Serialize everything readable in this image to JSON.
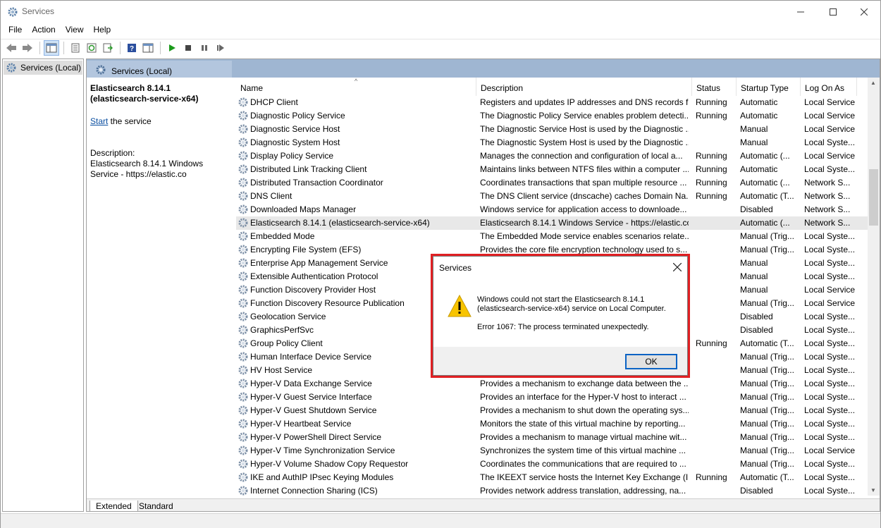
{
  "window": {
    "title": "Services"
  },
  "menu": [
    "File",
    "Action",
    "View",
    "Help"
  ],
  "tree": {
    "root_label": "Services (Local)"
  },
  "pane": {
    "header_title": "Services (Local)"
  },
  "detail": {
    "service_title": "Elasticsearch 8.14.1 (elasticsearch-service-x64)",
    "start_link": "Start",
    "start_suffix": " the service",
    "description_label": "Description:",
    "description_text": "Elasticsearch 8.14.1 Windows Service - https://elastic.co"
  },
  "columns": [
    "Name",
    "Description",
    "Status",
    "Startup Type",
    "Log On As"
  ],
  "services": [
    [
      "DHCP Client",
      "Registers and updates IP addresses and DNS records f...",
      "Running",
      "Automatic",
      "Local Service"
    ],
    [
      "Diagnostic Policy Service",
      "The Diagnostic Policy Service enables problem detecti...",
      "Running",
      "Automatic",
      "Local Service"
    ],
    [
      "Diagnostic Service Host",
      "The Diagnostic Service Host is used by the Diagnostic ...",
      "",
      "Manual",
      "Local Service"
    ],
    [
      "Diagnostic System Host",
      "The Diagnostic System Host is used by the Diagnostic ...",
      "",
      "Manual",
      "Local Syste..."
    ],
    [
      "Display Policy Service",
      "Manages the connection and configuration of local a...",
      "Running",
      "Automatic (...",
      "Local Service"
    ],
    [
      "Distributed Link Tracking Client",
      "Maintains links between NTFS files within a computer ...",
      "Running",
      "Automatic",
      "Local Syste..."
    ],
    [
      "Distributed Transaction Coordinator",
      "Coordinates transactions that span multiple resource ...",
      "Running",
      "Automatic (...",
      "Network S..."
    ],
    [
      "DNS Client",
      "The DNS Client service (dnscache) caches Domain Na...",
      "Running",
      "Automatic (T...",
      "Network S..."
    ],
    [
      "Downloaded Maps Manager",
      "Windows service for application access to downloade...",
      "",
      "Disabled",
      "Network S..."
    ],
    [
      "Elasticsearch 8.14.1 (elasticsearch-service-x64)",
      "Elasticsearch 8.14.1 Windows Service - https://elastic.co",
      "",
      "Automatic (...",
      "Network S..."
    ],
    [
      "Embedded Mode",
      "The Embedded Mode service enables scenarios relate...",
      "",
      "Manual (Trig...",
      "Local Syste..."
    ],
    [
      "Encrypting File System (EFS)",
      "Provides the core file encryption technology used to s...",
      "",
      "Manual (Trig...",
      "Local Syste..."
    ],
    [
      "Enterprise App Management Service",
      "",
      "",
      "Manual",
      "Local Syste..."
    ],
    [
      "Extensible Authentication Protocol",
      "",
      "",
      "Manual",
      "Local Syste..."
    ],
    [
      "Function Discovery Provider Host",
      "",
      "",
      "Manual",
      "Local Service"
    ],
    [
      "Function Discovery Resource Publication",
      "",
      "",
      "Manual (Trig...",
      "Local Service"
    ],
    [
      "Geolocation Service",
      "",
      "",
      "Disabled",
      "Local Syste..."
    ],
    [
      "GraphicsPerfSvc",
      "",
      "",
      "Disabled",
      "Local Syste..."
    ],
    [
      "Group Policy Client",
      "",
      "Running",
      "Automatic (T...",
      "Local Syste..."
    ],
    [
      "Human Interface Device Service",
      "",
      "",
      "Manual (Trig...",
      "Local Syste..."
    ],
    [
      "HV Host Service",
      "",
      "",
      "Manual (Trig...",
      "Local Syste..."
    ],
    [
      "Hyper-V Data Exchange Service",
      "Provides a mechanism to exchange data between the ...",
      "",
      "Manual (Trig...",
      "Local Syste..."
    ],
    [
      "Hyper-V Guest Service Interface",
      "Provides an interface for the Hyper-V host to interact ...",
      "",
      "Manual (Trig...",
      "Local Syste..."
    ],
    [
      "Hyper-V Guest Shutdown Service",
      "Provides a mechanism to shut down the operating sys...",
      "",
      "Manual (Trig...",
      "Local Syste..."
    ],
    [
      "Hyper-V Heartbeat Service",
      "Monitors the state of this virtual machine by reporting...",
      "",
      "Manual (Trig...",
      "Local Syste..."
    ],
    [
      "Hyper-V PowerShell Direct Service",
      "Provides a mechanism to manage virtual machine wit...",
      "",
      "Manual (Trig...",
      "Local Syste..."
    ],
    [
      "Hyper-V Time Synchronization Service",
      "Synchronizes the system time of this virtual machine ...",
      "",
      "Manual (Trig...",
      "Local Service"
    ],
    [
      "Hyper-V Volume Shadow Copy Requestor",
      "Coordinates the communications that are required to ...",
      "",
      "Manual (Trig...",
      "Local Syste..."
    ],
    [
      "IKE and AuthIP IPsec Keying Modules",
      "The IKEEXT service hosts the Internet Key Exchange (IK...",
      "Running",
      "Automatic (T...",
      "Local Syste..."
    ],
    [
      "Internet Connection Sharing (ICS)",
      "Provides network address translation, addressing, na...",
      "",
      "Disabled",
      "Local Syste..."
    ]
  ],
  "selected_service": "Elasticsearch 8.14.1 (elasticsearch-service-x64)",
  "tabs": {
    "extended": "Extended",
    "standard": "Standard"
  },
  "dialog": {
    "title": "Services",
    "message_line1": "Windows could not start the Elasticsearch 8.14.1",
    "message_line2": "(elasticsearch-service-x64) service on Local Computer.",
    "error": "Error 1067: The process terminated unexpectedly.",
    "ok_label": "OK",
    "highlight_color": "#e02023"
  }
}
